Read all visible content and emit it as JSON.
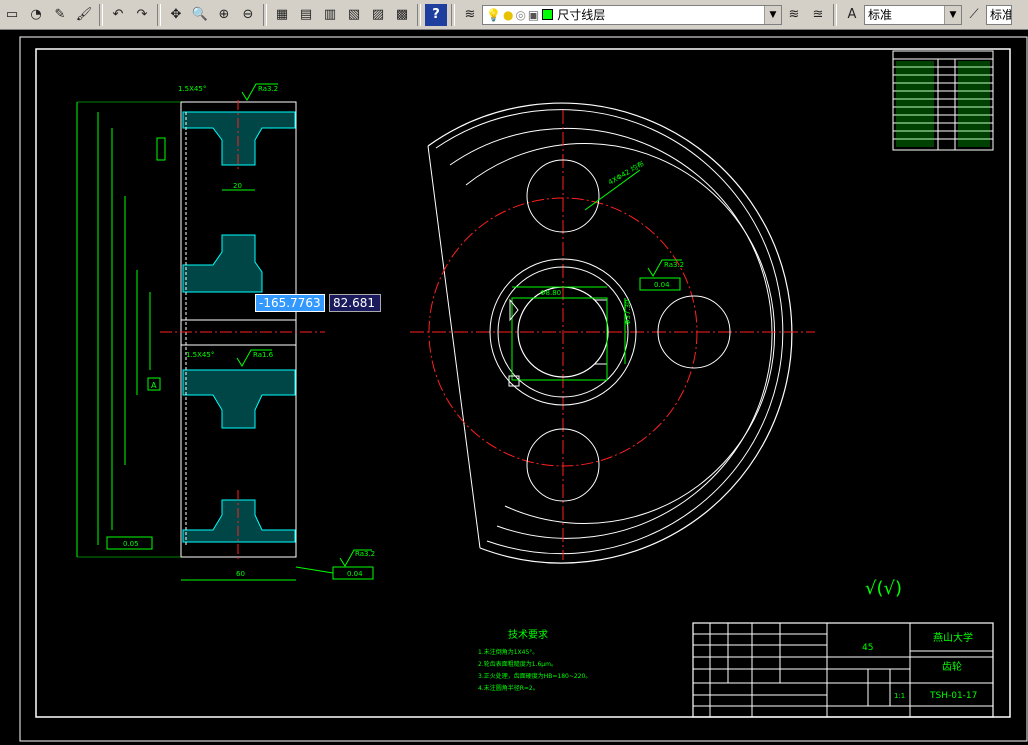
{
  "toolbar": {
    "layer_name": "尺寸线层",
    "text_style": "标准",
    "dim_style": "标准"
  },
  "dynamic_input": {
    "x": "-165.7763",
    "y": "82.681"
  },
  "drawing": {
    "chamfer_top": "1.5X45°",
    "chamfer_mid": "1.5X45°",
    "roughness_1": "Ra3.2",
    "roughness_2": "Ra1.6",
    "roughness_3": "Ra3.2",
    "roughness_4": "Ra3.2",
    "dim_width": "60",
    "dim_web": "20",
    "tol_1": "0.05",
    "tol_2": "0.04",
    "tol_3": "0.04",
    "datum_a": "A",
    "hole_note": "4XΦ42 均布",
    "key_width": "Φ8.80",
    "key_depth": "Φ37.30",
    "finish_mark": "√(√)",
    "tech_title": "技术要求",
    "tech_notes": [
      "1.未注倒角为1X45°。",
      "2.轮齿表面粗糙度为1.6μm。",
      "3.正火处理，齿面硬度为HB=180~220。",
      "4.未注圆角半径R=2。"
    ],
    "title_material": "45",
    "title_school": "燕山大学",
    "title_part": "齿轮",
    "title_code": "TSH-01-17",
    "title_scale": "1:1"
  }
}
